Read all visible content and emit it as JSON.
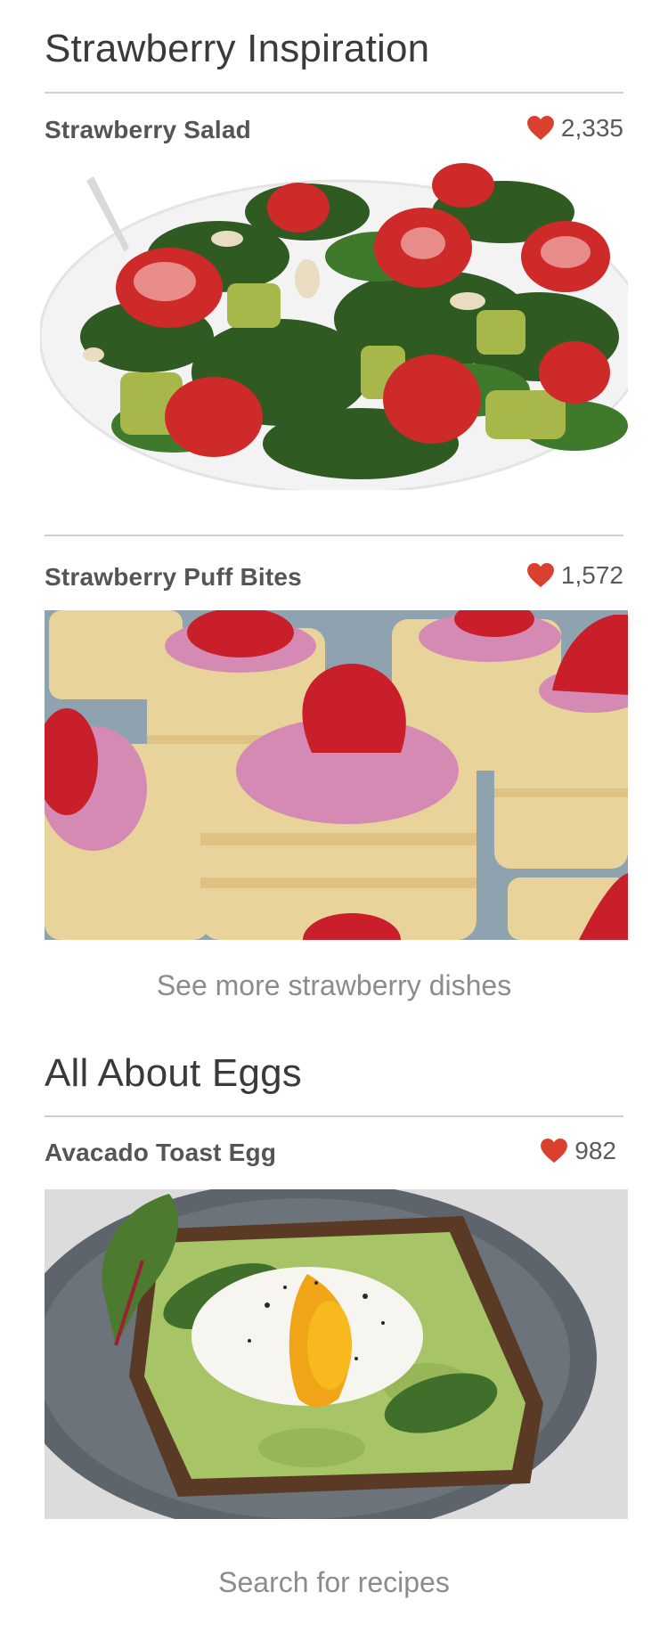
{
  "sections": [
    {
      "title": "Strawberry Inspiration",
      "cards": [
        {
          "title": "Strawberry Salad",
          "likes": "2,335",
          "image": "strawberry-spinach-salad-photo"
        },
        {
          "title": "Strawberry Puff Bites",
          "likes": "1,572",
          "image": "strawberry-puff-pastry-bites-photo"
        }
      ],
      "more_link": "See more strawberry dishes"
    },
    {
      "title": "All About Eggs",
      "cards": [
        {
          "title": "Avacado Toast Egg",
          "likes": "982",
          "image": "avocado-toast-poached-egg-photo"
        }
      ]
    }
  ],
  "search_link": "Search for recipes",
  "colors": {
    "heart": "#d9412e",
    "rule": "#cfcfcf",
    "link": "#8c8c8c"
  },
  "icons": {
    "like": "heart-icon"
  }
}
